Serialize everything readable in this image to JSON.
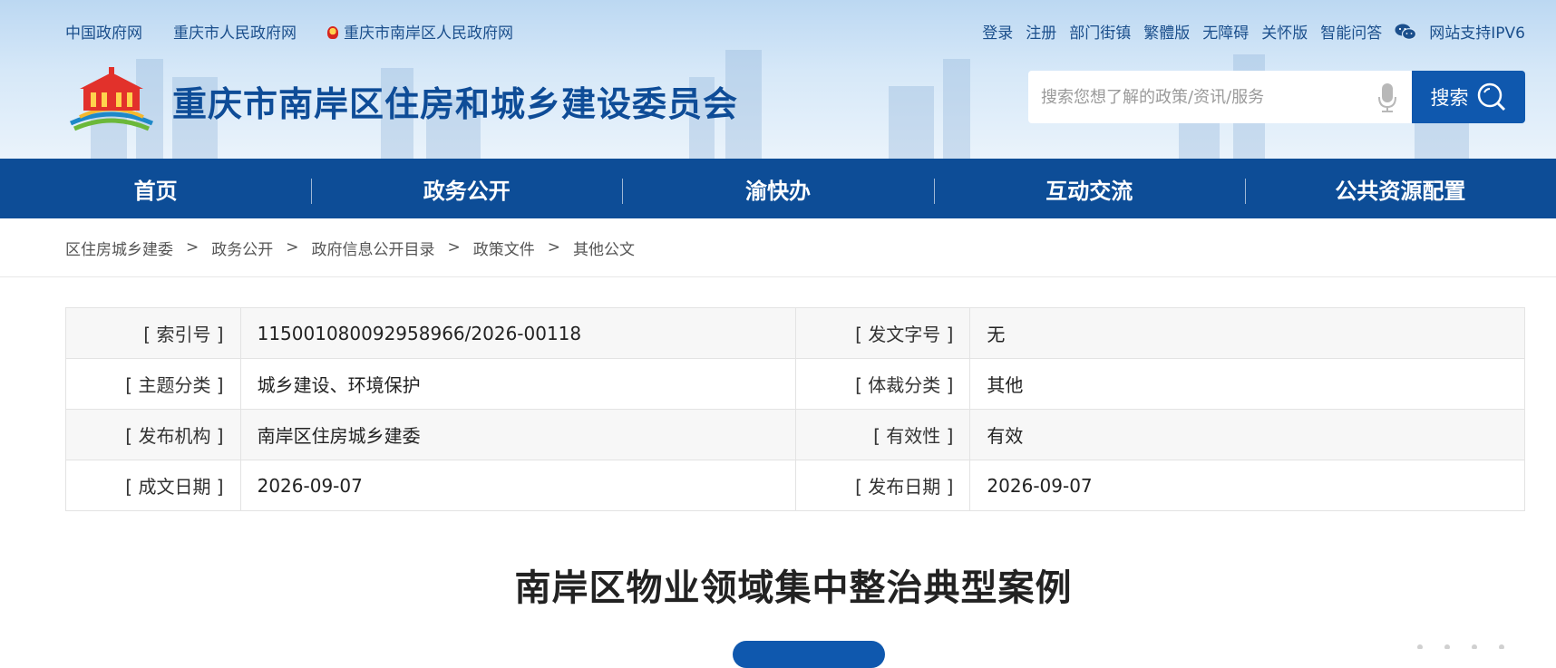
{
  "top_links_left": [
    "中国政府网",
    "重庆市人民政府网",
    "重庆市南岸区人民政府网"
  ],
  "top_links_right": [
    "登录",
    "注册",
    "部门街镇",
    "繁體版",
    "无障碍",
    "关怀版",
    "智能问答"
  ],
  "ipv6_label": "网站支持IPV6",
  "site_title": "重庆市南岸区住房和城乡建设委员会",
  "search": {
    "placeholder": "搜索您想了解的政策/资讯/服务",
    "button_label": "搜索"
  },
  "nav": [
    "首页",
    "政务公开",
    "渝快办",
    "互动交流",
    "公共资源配置"
  ],
  "breadcrumb": [
    "区住房城乡建委",
    "政务公开",
    "政府信息公开目录",
    "政策文件",
    "其他公文"
  ],
  "info": [
    {
      "k1": "[ 索引号 ]",
      "v1": "115001080092958966/2026-00118",
      "k2": "[ 发文字号 ]",
      "v2": "无"
    },
    {
      "k1": "[ 主题分类 ]",
      "v1": "城乡建设、环境保护",
      "k2": "[ 体裁分类 ]",
      "v2": "其他"
    },
    {
      "k1": "[ 发布机构 ]",
      "v1": "南岸区住房城乡建委",
      "k2": "[ 有效性 ]",
      "v2": "有效"
    },
    {
      "k1": "[ 成文日期 ]",
      "v1": "2026-09-07",
      "k2": "[ 发布日期 ]",
      "v2": "2026-09-07"
    }
  ],
  "article_title": "南岸区物业领域集中整治典型案例",
  "colors": {
    "brand_blue": "#0d4d97",
    "button_blue": "#0f58ae",
    "title_blue": "#0e4c97"
  }
}
